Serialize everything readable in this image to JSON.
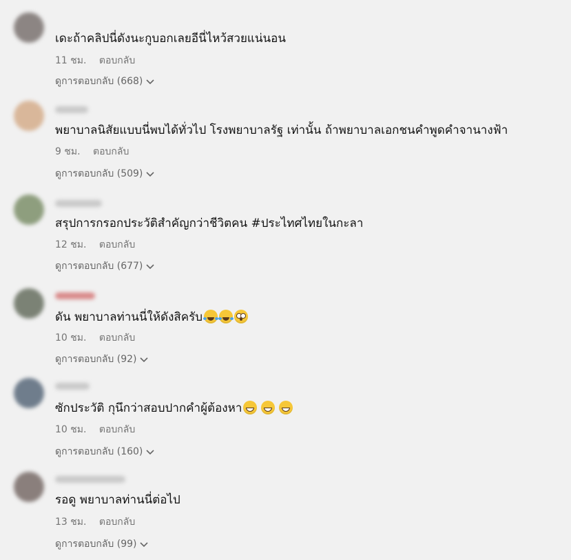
{
  "comments": [
    {
      "text": "เดะถ้าคลิปนี่ดังนะกูบอกเลยอีนี่ไหว้สวยแน่นอน",
      "time": "11 ชม.",
      "reply": "ตอบกลับ",
      "view_replies": "ดูการตอบกลับ (668)",
      "avatar_color": "#8c8583",
      "emojis": []
    },
    {
      "text": "พยาบาลนิสัยแบบนี่พบได้ทั่วไป โรงพยาบาลรัฐ เท่านั้น ถ้าพยาบาลเอกชนคำพูดคำจานางฟ้า",
      "time": "9 ชม.",
      "reply": "ตอบกลับ",
      "view_replies": "ดูการตอบกลับ (509)",
      "avatar_color": "#d9b79a",
      "emojis": []
    },
    {
      "text": "สรุปการกรอกประวัติสำคัญกว่าชีวิตคน #ประไทศไทยในกะลา",
      "time": "12 ชม.",
      "reply": "ตอบกลับ",
      "view_replies": "ดูการตอบกลับ (677)",
      "avatar_color": "#8e9e7e",
      "emojis": []
    },
    {
      "text": "ดัน พยาบาลท่านนี่ให้ดังสิครับ",
      "time": "10 ชม.",
      "reply": "ตอบกลับ",
      "view_replies": "ดูการตอบกลับ (92)",
      "avatar_color": "#7b8275",
      "emojis": [
        "laugh",
        "laugh",
        "flush"
      ]
    },
    {
      "text": "ซักประวัติ กุนึกว่าสอบปากคำผู้ต้องหา",
      "time": "10 ชม.",
      "reply": "ตอบกลับ",
      "view_replies": "ดูการตอบกลับ (160)",
      "avatar_color": "#6f7d8c",
      "emojis": [
        "grin",
        "grin",
        "grin"
      ]
    },
    {
      "text": "รอดู พยาบาลท่านนี่ต่อไป",
      "time": "13 ชม.",
      "reply": "ตอบกลับ",
      "view_replies": "ดูการตอบกลับ (99)",
      "avatar_color": "#8a7f7c",
      "emojis": []
    }
  ],
  "colors": {
    "background": "#f1f1f1",
    "text": "#111111",
    "meta": "#737373"
  }
}
